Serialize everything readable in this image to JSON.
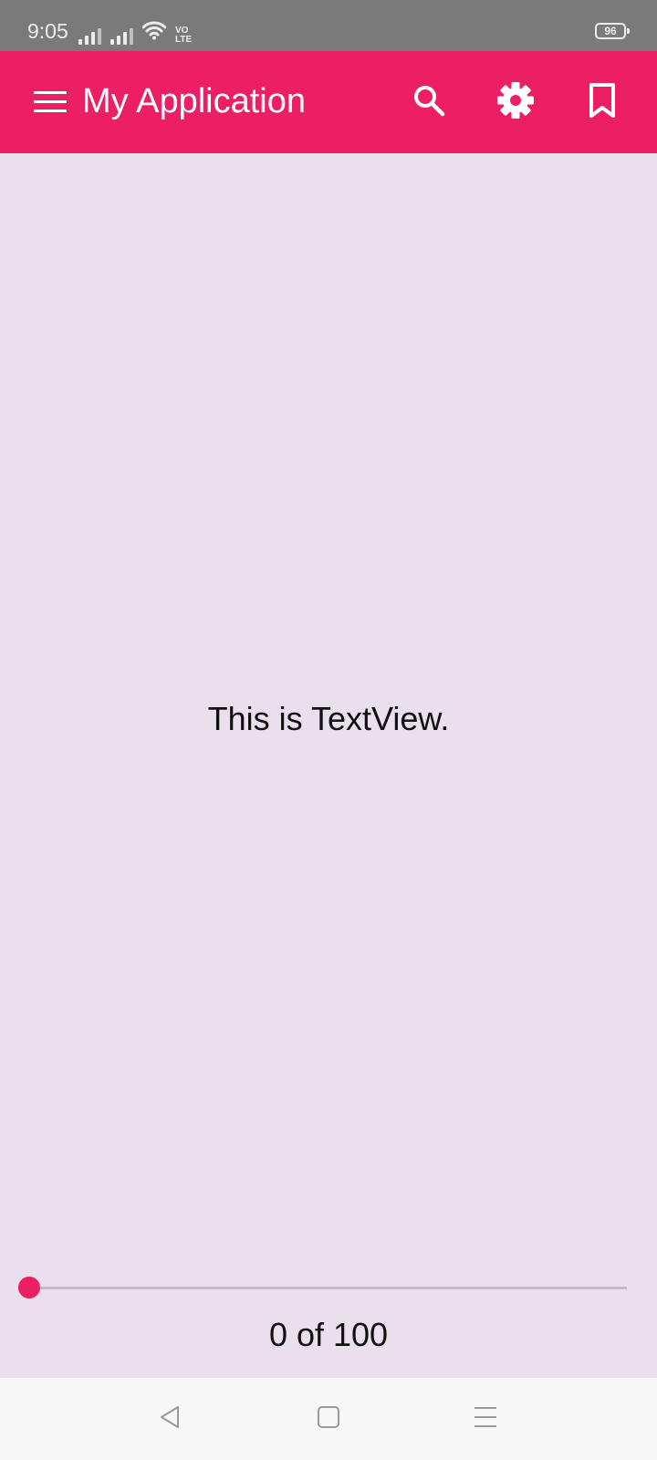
{
  "status_bar": {
    "time": "9:05",
    "volte_line1": "VO",
    "volte_line2": "LTE",
    "battery": "96",
    "icons": [
      "signal-icon",
      "signal-icon",
      "wifi-icon",
      "volte-icon",
      "battery-icon"
    ]
  },
  "app_bar": {
    "title": "My Application",
    "icons": [
      "menu-icon",
      "search-icon",
      "settings-icon",
      "bookmark-icon"
    ],
    "color": "#EC1E64"
  },
  "main": {
    "text": "This is TextView."
  },
  "seekbar": {
    "value": 0,
    "max": 100,
    "label": "0 of 100"
  },
  "nav_bar": {
    "icons": [
      "back-icon",
      "home-icon",
      "recents-icon"
    ]
  },
  "colors": {
    "accent": "#EC1E64",
    "background": "#EADFEC",
    "status_bar": "#7A7A7A",
    "nav_bar": "#F7F7F7"
  }
}
